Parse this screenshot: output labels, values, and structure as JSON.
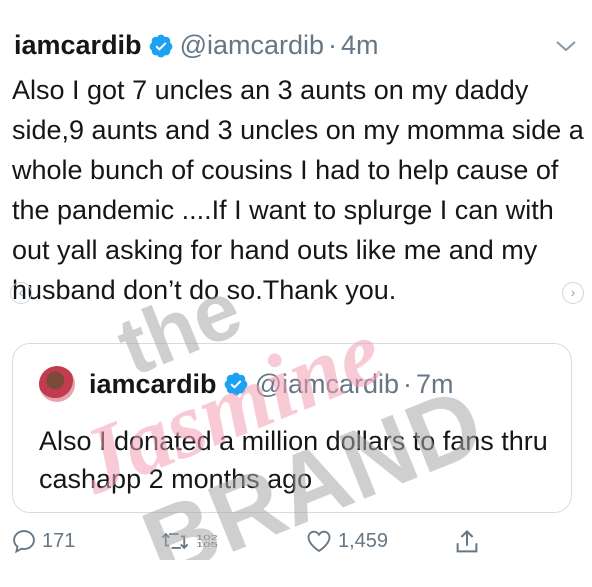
{
  "tweet": {
    "display_name": "iamcardib",
    "handle": "@iamcardib",
    "separator": "·",
    "time": "4m",
    "text": "Also I got 7 uncles an 3 aunts on my daddy side,9 aunts and 3 uncles on my momma side a whole bunch of cousins I had to help cause of the pandemic ....If I want to splurge I can with out yall asking for hand outs like me and my husband don’t do so.Thank you."
  },
  "quote": {
    "display_name": "iamcardib",
    "handle": "@iamcardib",
    "separator": "·",
    "time": "7m",
    "text": "Also I donated a million dollars to fans thru cashapp 2 months ago"
  },
  "actions": {
    "replies": "171",
    "retweets_top": "102",
    "retweets_bottom": "105",
    "likes": "1,459"
  },
  "watermark": {
    "line1": "the",
    "line2": "Jasmine",
    "line3": "BRAND"
  },
  "icons": {
    "verified": "verified-badge-icon",
    "caret": "chevron-down-icon",
    "reply": "reply-icon",
    "retweet": "retweet-icon",
    "like": "heart-icon",
    "share": "share-icon"
  },
  "colors": {
    "verified_blue": "#1da1f2",
    "secondary_text": "#657786",
    "primary_text": "#14171a",
    "watermark_pink": "#f2a0b5",
    "watermark_gray": "#a8a8a8"
  }
}
